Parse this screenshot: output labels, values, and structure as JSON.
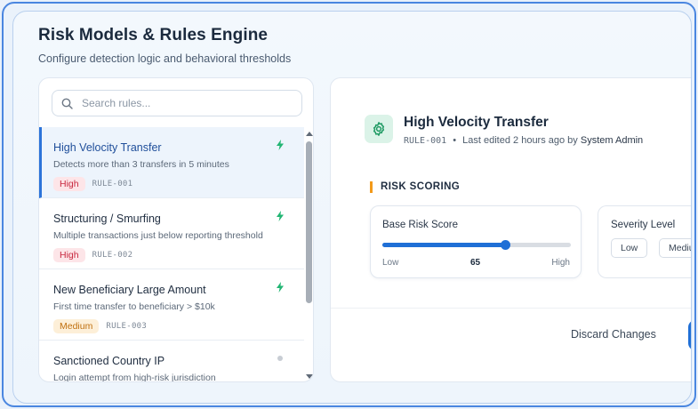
{
  "header": {
    "title": "Risk Models & Rules Engine",
    "subtitle": "Configure detection logic and behavioral thresholds"
  },
  "search": {
    "placeholder": "Search rules..."
  },
  "rules": [
    {
      "name": "High Velocity Transfer",
      "description": "Detects more than 3 transfers in 5 minutes",
      "severity": "High",
      "id": "RULE-001",
      "status_icon": "bolt-icon",
      "active": true
    },
    {
      "name": "Structuring / Smurfing",
      "description": "Multiple transactions just below reporting threshold",
      "severity": "High",
      "id": "RULE-002",
      "status_icon": "bolt-icon",
      "active": false
    },
    {
      "name": "New Beneficiary Large Amount",
      "description": "First time transfer to beneficiary > $10k",
      "severity": "Medium",
      "id": "RULE-003",
      "status_icon": "bolt-icon",
      "active": false
    },
    {
      "name": "Sanctioned Country IP",
      "description": "Login attempt from high-risk jurisdiction",
      "severity": "",
      "id": "",
      "status_icon": "inactive-dot-icon",
      "active": false
    }
  ],
  "detail": {
    "icon": "gear-icon",
    "title": "High Velocity Transfer",
    "rule_id": "RULE-001",
    "separator": "•",
    "edited_prefix": "Last edited 2 hours ago by",
    "editor": "System Admin",
    "section_label": "RISK SCORING",
    "score": {
      "label": "Base Risk Score",
      "value": 65,
      "value_text": "65",
      "min_label": "Low",
      "max_label": "High"
    },
    "severity": {
      "label": "Severity Level",
      "options": [
        "Low",
        "Medium"
      ]
    },
    "actions": {
      "discard_label": "Discard Changes"
    }
  },
  "colors": {
    "accent": "#1f6fd6",
    "high_bg": "#fde5e8",
    "high_text": "#c8283f",
    "medium_bg": "#fdefd8",
    "medium_text": "#c07010",
    "bolt": "#22b573",
    "section_marker": "#f39a1a"
  }
}
